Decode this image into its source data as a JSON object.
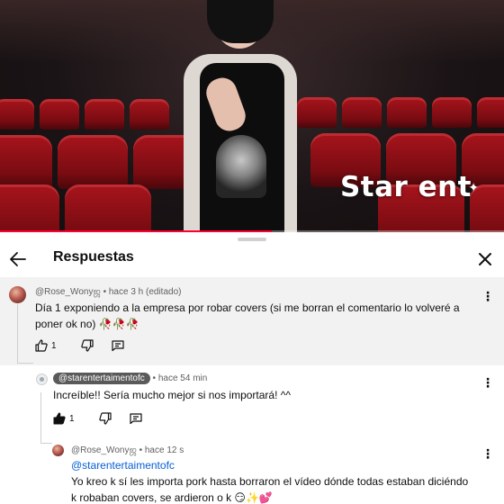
{
  "video": {
    "overlay_text": "Star ent",
    "progress_fraction": 0.54,
    "colors": {
      "progress": "#ff0033",
      "seats": "#a8141c"
    }
  },
  "panel": {
    "title": "Respuestas",
    "back_icon": "arrow-left-icon",
    "close_icon": "close-icon"
  },
  "comments": [
    {
      "author": "@Rose_Wonyஜ",
      "time": "hace 3 h (editado)",
      "text": "Día 1 exponiendo a la empresa por robar covers (si me borran el comentario lo volveré a poner ok no) 🥀🥀🥀",
      "likes": "1",
      "liked": false,
      "is_creator": false
    },
    {
      "author": "@starentertaimentofc",
      "time": "hace 54 min",
      "text": "Increíble!! Sería mucho mejor si nos importará! ^^",
      "likes": "1",
      "liked": true,
      "is_creator": true
    },
    {
      "author": "@Rose_Wonyஜ",
      "time": "hace 12 s",
      "mention": "@starentertaimentofc",
      "text": "Yo kreo k sí les importa pork hasta borraron el vídeo dónde todas estaban diciéndo k robaban covers, se ardieron o k 😏✨💕",
      "is_creator": false
    }
  ],
  "meta_separator": "•"
}
